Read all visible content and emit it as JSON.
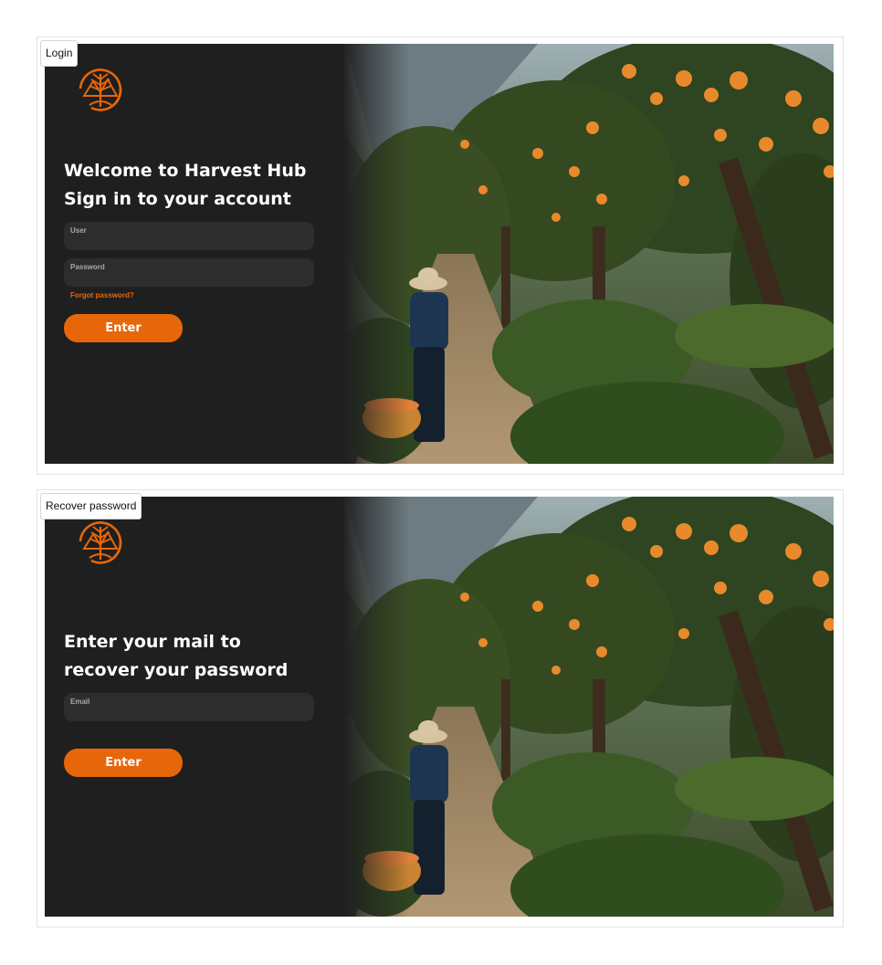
{
  "colors": {
    "accent": "#e8660a",
    "panel_background": "#1f1f1f",
    "field_background": "#2d2d2d",
    "text_primary": "#ffffff",
    "text_label": "#a9a9a9"
  },
  "login_screen": {
    "frame_label": "Login",
    "logo_icon": "harvest-tree-logo-icon",
    "heading_line1": "Welcome to Harvest Hub",
    "heading_line2": "Sign in to your account",
    "user_field": {
      "label": "User",
      "value": ""
    },
    "password_field": {
      "label": "Password",
      "value": ""
    },
    "forgot_link": "Forgot password?",
    "enter_button": "Enter",
    "background_image": "orange-grove-farmer-photo"
  },
  "recover_screen": {
    "frame_label": "Recover password",
    "logo_icon": "harvest-tree-logo-icon",
    "heading_line1": "Enter your mail to",
    "heading_line2": "recover your password",
    "email_field": {
      "label": "Email",
      "value": ""
    },
    "enter_button": "Enter",
    "background_image": "orange-grove-farmer-photo"
  }
}
